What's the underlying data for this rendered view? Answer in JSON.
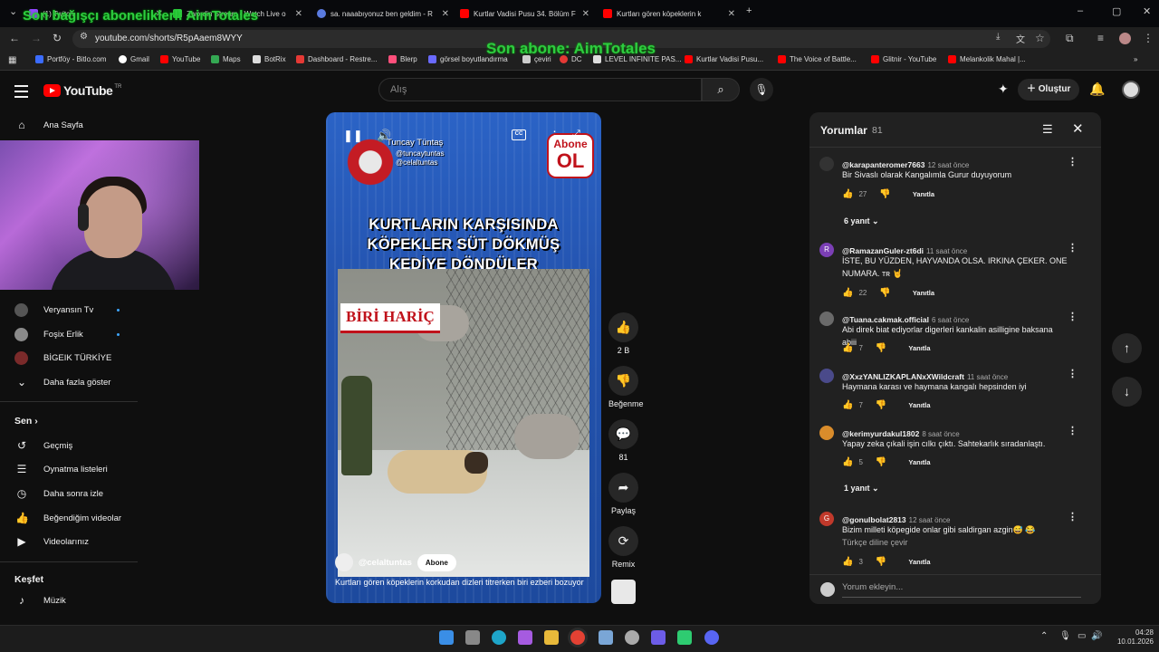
{
  "browser": {
    "tabs": [
      {
        "label": "(1) Twitch",
        "color": "#9146ff"
      },
      {
        "label": "Zwordin Stream - Watch Live o",
        "color": "#2ecc40"
      },
      {
        "label": "sa. naaabıyonuz ben geldim - R",
        "color": "#5a7be0"
      },
      {
        "label": "Kurtlar Vadisi Pusu 34. Bölüm F",
        "color": "#ff0000"
      },
      {
        "label": "Kurtları gören köpeklerin k",
        "color": "#ff0000"
      }
    ],
    "url": "youtube.com/shorts/R5pAaem8WYY",
    "bookmarks": [
      {
        "label": "Portföy - Bitlo.com",
        "color": "#3b6cff"
      },
      {
        "label": "Gmail",
        "color": "#ffffff"
      },
      {
        "label": "YouTube",
        "color": "#ff0000"
      },
      {
        "label": "Maps",
        "color": "#34a853"
      },
      {
        "label": "BotRix",
        "color": "#dddddd"
      },
      {
        "label": "Dashboard - Restre...",
        "color": "#e53935"
      },
      {
        "label": "Blerp",
        "color": "#ff4f7b"
      },
      {
        "label": "görsel boyutlandırma",
        "color": "#6a6aff"
      },
      {
        "label": "çeviri",
        "color": "#cccccc"
      },
      {
        "label": "DC",
        "color": "#e53935"
      },
      {
        "label": "LEVEL INFINITE PAS...",
        "color": "#dddddd"
      },
      {
        "label": "Kurtlar Vadisi Pusu...",
        "color": "#ff0000"
      },
      {
        "label": "The Voice of Battle...",
        "color": "#ff0000"
      },
      {
        "label": "Glitnir - YouTube",
        "color": "#ff0000"
      },
      {
        "label": "Melankolik Mahal |...",
        "color": "#ff0000"
      }
    ]
  },
  "overlay": {
    "donor": "Son bağışçı aboneliklerl: AimTotales",
    "subscriber": "Son abone: AimTotales"
  },
  "header": {
    "logo": "YouTube",
    "region": "TR",
    "search_placeholder": "Alış",
    "create_label": "Oluştur"
  },
  "sidebar": {
    "home": "Ana Sayfa",
    "channels": [
      {
        "label": "Veryansın Tv",
        "color": "#555555",
        "dot": true
      },
      {
        "label": "Foşix Erlik",
        "color": "#8a8a8a",
        "dot": true
      },
      {
        "label": "BİGEIK TÜRKİYE",
        "color": "#7a2a2a",
        "dot": false
      }
    ],
    "show_more": "Daha fazla göster",
    "you_section": "Sen",
    "you_items": [
      "Geçmiş",
      "Oynatma listeleri",
      "Daha sonra izle",
      "Beğendiğim videolar",
      "Videolarınız"
    ],
    "explore_section": "Keşfet",
    "explore_items": [
      "Müzik"
    ]
  },
  "video": {
    "title_lines": [
      "KURTLARIN KARŞISINDA",
      "KÖPEKLER SÜT DÖKMÜŞ",
      "KEDİYE DÖNDÜLER"
    ],
    "badge": "BİRİ HARİÇ",
    "creator_name": "Tuncay Tüntaş",
    "creator_handles": [
      "@tuncaytuntas",
      "@celaltuntas"
    ],
    "promo_top": "Abone",
    "promo_bottom": "OL",
    "channel": "@celaltuntas",
    "subscribe": "Abone",
    "caption": "Kurtları gören köpeklerin korkudan dizleri titrerken biri ezberi bozuyor"
  },
  "actions": {
    "likes": "2 B",
    "dislike": "Beğenme",
    "comments": "81",
    "share": "Paylaş",
    "remix": "Remix"
  },
  "comments_panel": {
    "title": "Yorumlar",
    "count": "81",
    "reply_label": "Yanıtla",
    "add_placeholder": "Yorum ekleyin...",
    "comments": [
      {
        "user": "@karapanteromer7663",
        "time": "12 saat önce",
        "text": "Bir Sivaslı olarak Kangalımla Gurur duyuyorum",
        "likes": "27",
        "replies": "6 yanıt",
        "avatar_color": "#333333",
        "initial": ""
      },
      {
        "user": "@RamazanGuler-zt6di",
        "time": "11 saat önce",
        "text": "İSTE, BU YÜZDEN, HAYVANDA OLSA. IRKINA ÇEKER. ONE NUMARA. ᴛʀ 🤘",
        "likes": "22",
        "replies": "",
        "avatar_color": "#7b3fb5",
        "initial": "R"
      },
      {
        "user": "@Tuana.cakmak.official",
        "time": "6 saat önce",
        "text": "Abi direk biat ediyorlar digerleri kankalin asilligine baksana abiii",
        "likes": "7",
        "replies": "",
        "avatar_color": "#6a6a6a",
        "initial": ""
      },
      {
        "user": "@XxzYANLIZKAPLANxXWildcraft",
        "time": "11 saat önce",
        "text": "Haymana karası ve haymana kangalı hepsinden iyi",
        "likes": "7",
        "replies": "",
        "avatar_color": "#4a4a8a",
        "initial": ""
      },
      {
        "user": "@kerimyurdakul1802",
        "time": "8 saat önce",
        "text": "Yapay zeka çıkali işin cılkı çıktı. Sahtekarlık sıradanlaştı.",
        "likes": "5",
        "replies": "1 yanıt",
        "avatar_color": "#d98c2b",
        "initial": ""
      },
      {
        "user": "@gonulbolat2813",
        "time": "12 saat önce",
        "text": "Bizim milleti köpegide onlar gibi saldirgan azgin😅 😂",
        "likes": "3",
        "replies": "",
        "avatar_color": "#c0392b",
        "initial": "G",
        "translate": "Türkçe diline çevir"
      }
    ]
  },
  "taskbar": {
    "time": "04:28",
    "date": "10.01.2026"
  }
}
